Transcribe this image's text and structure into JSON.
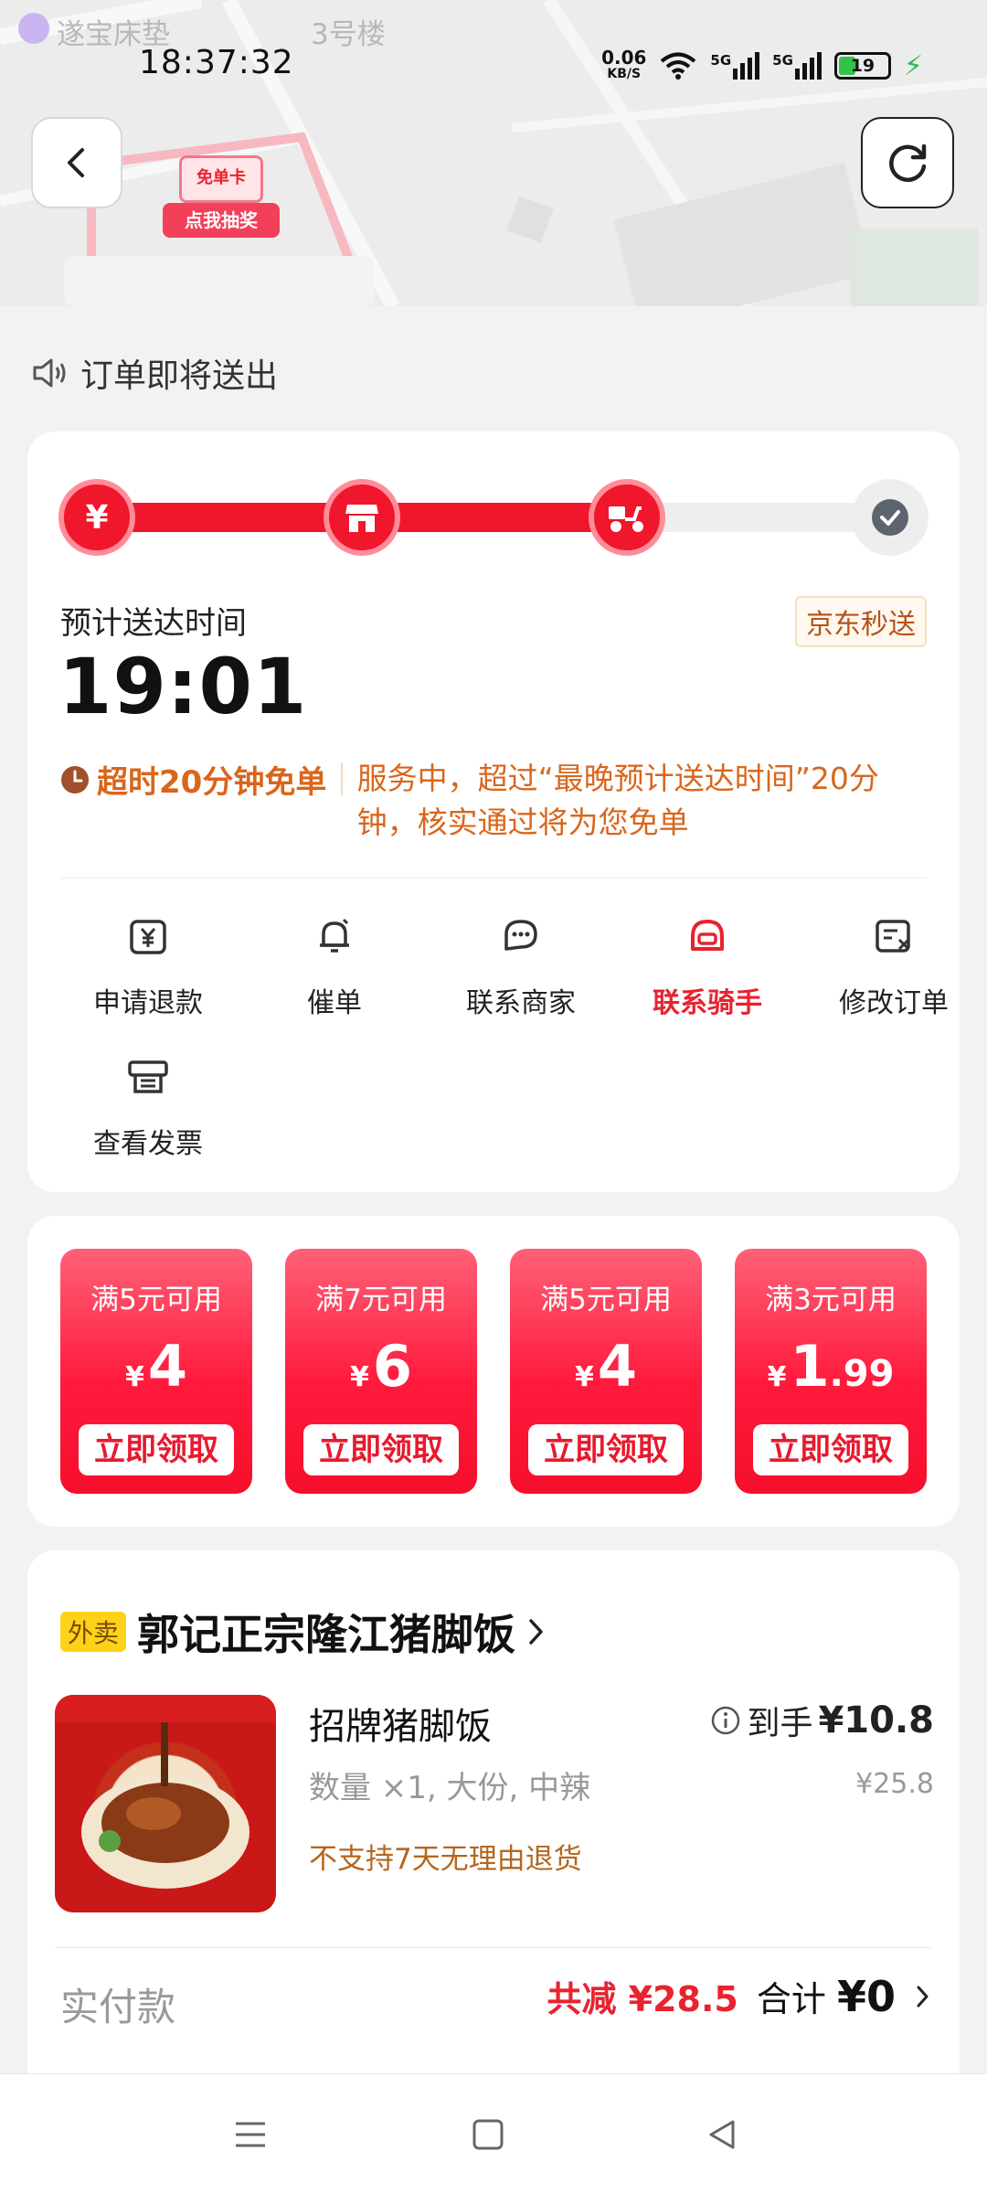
{
  "status_bar": {
    "time": "18:37:32",
    "net_speed": "0.06",
    "net_unit": "KB/S",
    "sim1": "5G",
    "sim2": "5G",
    "battery": "19"
  },
  "map": {
    "label_left": "遂宝床垫",
    "label_mid": "3号楼",
    "badge_top": "免单卡",
    "badge_bottom": "点我抽奖"
  },
  "announcement": {
    "icon": "speaker-icon",
    "text": "订单即将送出"
  },
  "progress": {
    "steps": [
      "yen-icon",
      "store-icon",
      "scooter-icon",
      "check-icon"
    ],
    "current_step": 3,
    "total_steps": 4,
    "accent": "#f0162c"
  },
  "delivery": {
    "eta_label": "预计送达时间",
    "eta_time": "19:01",
    "service_tag": "京东秒送",
    "guarantee_title": "超时20分钟免单",
    "guarantee_text": "服务中，超过“最晚预计送达时间”20分钟，核实通过将为您免单"
  },
  "actions": [
    {
      "label": "申请退款",
      "icon": "refund-icon"
    },
    {
      "label": "催单",
      "icon": "bell-icon"
    },
    {
      "label": "联系商家",
      "icon": "merchant-chat-icon"
    },
    {
      "label": "联系骑手",
      "icon": "rider-helmet-icon"
    },
    {
      "label": "修改订单",
      "icon": "edit-order-icon"
    },
    {
      "label": "查看发票",
      "icon": "invoice-icon"
    }
  ],
  "coupons": [
    {
      "condition": "满5元可用",
      "symbol": "¥",
      "amount": "4",
      "decimal": "",
      "button": "立即领取"
    },
    {
      "condition": "满7元可用",
      "symbol": "¥",
      "amount": "6",
      "decimal": "",
      "button": "立即领取"
    },
    {
      "condition": "满5元可用",
      "symbol": "¥",
      "amount": "4",
      "decimal": "",
      "button": "立即领取"
    },
    {
      "condition": "满3元可用",
      "symbol": "¥",
      "amount": "1",
      "decimal": ".99",
      "button": "立即领取"
    }
  ],
  "order": {
    "shop_tag": "外卖",
    "shop_name": "郭记正宗隆江猪脚饭",
    "product_name": "招牌猪脚饭",
    "product_spec": "数量 ×1, 大份, 中辣",
    "product_note": "不支持7天无理由退货",
    "price_label": "到手",
    "price_now": "¥10.8",
    "price_original": "¥25.8",
    "paid_label": "实付款",
    "discount": "共减 ¥28.5",
    "total_label": "合计",
    "total_value": "¥0"
  }
}
